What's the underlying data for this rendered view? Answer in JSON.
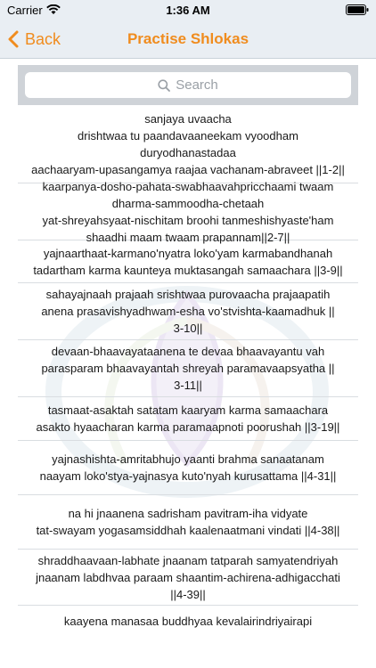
{
  "status": {
    "carrier": "Carrier",
    "time": "1:36 AM"
  },
  "nav": {
    "back_label": "Back",
    "title": "Practise Shlokas",
    "accent_color": "#f08c1e"
  },
  "search": {
    "placeholder": "Search"
  },
  "shlokas": [
    {
      "lines": [
        "sanjaya uvaacha",
        "drishtwaa tu paandavaaneekam vyoodham",
        "duryodhanastadaa",
        "aachaaryam-upasangamya raajaa vachanam-abraveet  ||1-2||"
      ]
    },
    {
      "lines": [
        "kaarpanya-dosho-pahata-swabhaavahpricchaami twaam",
        "dharma-sammoodha-chetaah",
        "yat-shreyahsyaat-nischitam broohi tanmeshishyaste'ham",
        "shaadhi maam twaam prapannam||2-7||"
      ]
    },
    {
      "lines": [
        "yajnaarthaat-karmano'nyatra loko'yam karmabandhanah",
        "tadartham karma kaunteya muktasangah samaachara  ||3-9||"
      ]
    },
    {
      "lines": [
        "sahayajnaah prajaah srishtwaa purovaacha prajaapatih",
        "anena prasavishyadhwam-esha vo'stvishta-kaamadhuk  ||",
        "3-10||"
      ]
    },
    {
      "lines": [
        "devaan-bhaavayataanena te devaa bhaavayantu vah",
        "parasparam bhaavayantah shreyah paramavaapsyatha  ||",
        "3-11||"
      ]
    },
    {
      "lines": [
        "tasmaat-asaktah satatam kaaryam karma samaachara",
        "asakto hyaacharan karma paramaapnoti poorushah  ||3-19||"
      ]
    },
    {
      "lines": [
        "yajnashishta-amritabhujo yaanti brahma sanaatanam",
        "naayam loko'stya-yajnasya kuto'nyah kurusattama ||4-31||"
      ]
    },
    {
      "lines": [
        "na hi jnaanena sadrisham pavitram-iha vidyate",
        "tat-swayam yogasamsiddhah kaalenaatmani vindati ||4-38||"
      ]
    },
    {
      "lines": [
        "shraddhaavaan-labhate jnaanam tatparah samyatendriyah",
        "jnaanam labdhvaa paraam shaantim-achirena-adhigacchati",
        "||4-39||"
      ]
    },
    {
      "lines": [
        "kaayena manasaa buddhyaa kevalairindriyairapi"
      ]
    }
  ]
}
